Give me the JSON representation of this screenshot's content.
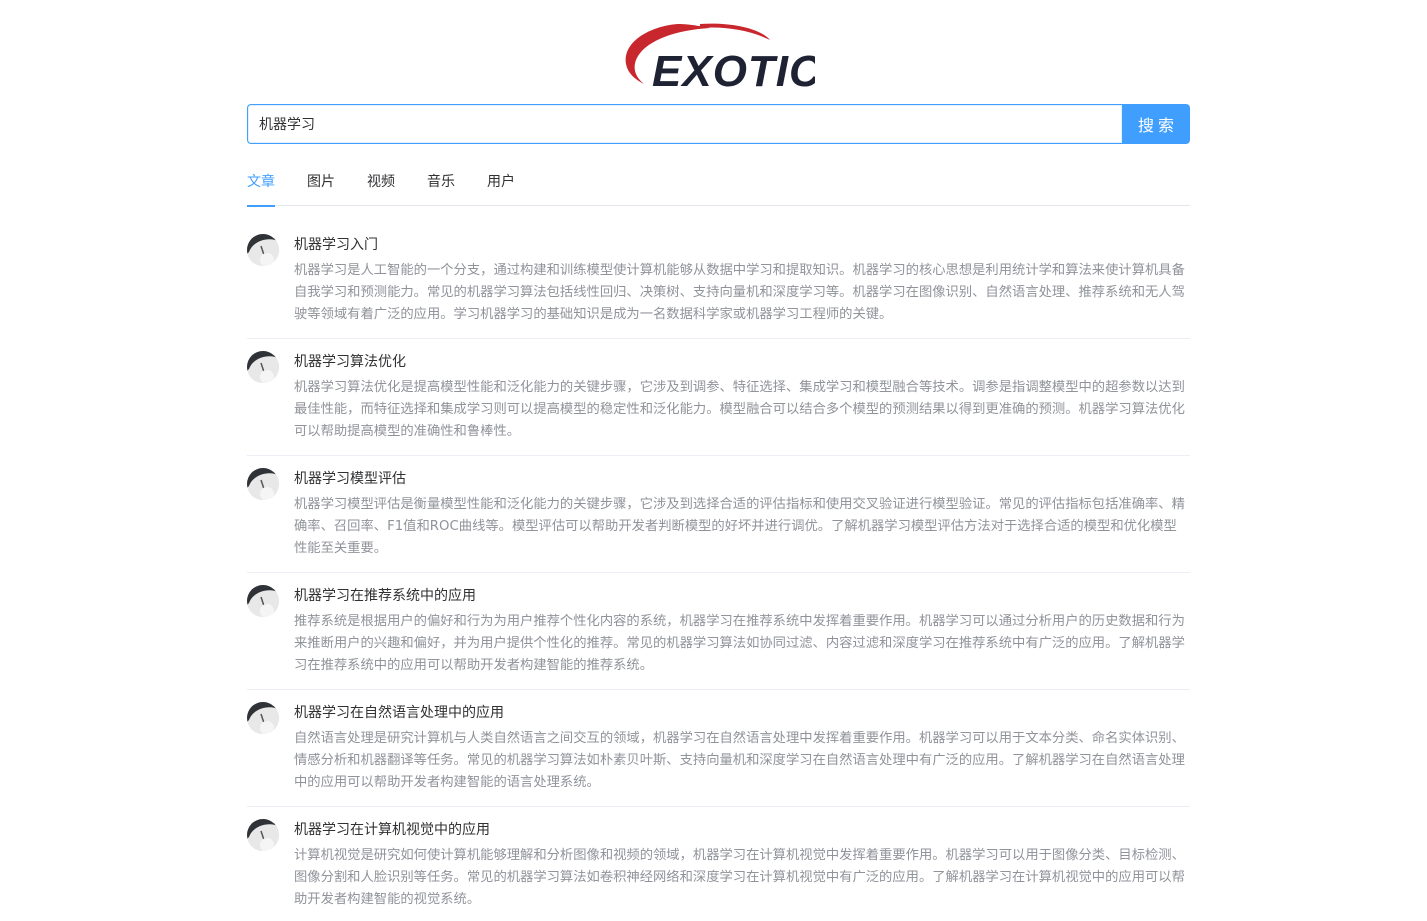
{
  "logo": {
    "text": "EXOTIC"
  },
  "search": {
    "value": "机器学习",
    "button_label": "搜索"
  },
  "tabs": [
    {
      "label": "文章",
      "active": true
    },
    {
      "label": "图片",
      "active": false
    },
    {
      "label": "视频",
      "active": false
    },
    {
      "label": "音乐",
      "active": false
    },
    {
      "label": "用户",
      "active": false
    }
  ],
  "results": [
    {
      "title": "机器学习入门",
      "desc": "机器学习是人工智能的一个分支，通过构建和训练模型使计算机能够从数据中学习和提取知识。机器学习的核心思想是利用统计学和算法来使计算机具备自我学习和预测能力。常见的机器学习算法包括线性回归、决策树、支持向量机和深度学习等。机器学习在图像识别、自然语言处理、推荐系统和无人驾驶等领域有着广泛的应用。学习机器学习的基础知识是成为一名数据科学家或机器学习工程师的关键。"
    },
    {
      "title": "机器学习算法优化",
      "desc": "机器学习算法优化是提高模型性能和泛化能力的关键步骤，它涉及到调参、特征选择、集成学习和模型融合等技术。调参是指调整模型中的超参数以达到最佳性能，而特征选择和集成学习则可以提高模型的稳定性和泛化能力。模型融合可以结合多个模型的预测结果以得到更准确的预测。机器学习算法优化可以帮助提高模型的准确性和鲁棒性。"
    },
    {
      "title": "机器学习模型评估",
      "desc": "机器学习模型评估是衡量模型性能和泛化能力的关键步骤，它涉及到选择合适的评估指标和使用交叉验证进行模型验证。常见的评估指标包括准确率、精确率、召回率、F1值和ROC曲线等。模型评估可以帮助开发者判断模型的好坏并进行调优。了解机器学习模型评估方法对于选择合适的模型和优化模型性能至关重要。"
    },
    {
      "title": "机器学习在推荐系统中的应用",
      "desc": "推荐系统是根据用户的偏好和行为为用户推荐个性化内容的系统，机器学习在推荐系统中发挥着重要作用。机器学习可以通过分析用户的历史数据和行为来推断用户的兴趣和偏好，并为用户提供个性化的推荐。常见的机器学习算法如协同过滤、内容过滤和深度学习在推荐系统中有广泛的应用。了解机器学习在推荐系统中的应用可以帮助开发者构建智能的推荐系统。"
    },
    {
      "title": "机器学习在自然语言处理中的应用",
      "desc": "自然语言处理是研究计算机与人类自然语言之间交互的领域，机器学习在自然语言处理中发挥着重要作用。机器学习可以用于文本分类、命名实体识别、情感分析和机器翻译等任务。常见的机器学习算法如朴素贝叶斯、支持向量机和深度学习在自然语言处理中有广泛的应用。了解机器学习在自然语言处理中的应用可以帮助开发者构建智能的语言处理系统。"
    },
    {
      "title": "机器学习在计算机视觉中的应用",
      "desc": "计算机视觉是研究如何使计算机能够理解和分析图像和视频的领域，机器学习在计算机视觉中发挥着重要作用。机器学习可以用于图像分类、目标检测、图像分割和人脸识别等任务。常见的机器学习算法如卷积神经网络和深度学习在计算机视觉中有广泛的应用。了解机器学习在计算机视觉中的应用可以帮助开发者构建智能的视觉系统。"
    }
  ],
  "colors": {
    "accent": "#409eff",
    "title": "#303133",
    "desc": "#909399",
    "logo_text": "#1e2233",
    "logo_swoosh": "#c8282d"
  }
}
